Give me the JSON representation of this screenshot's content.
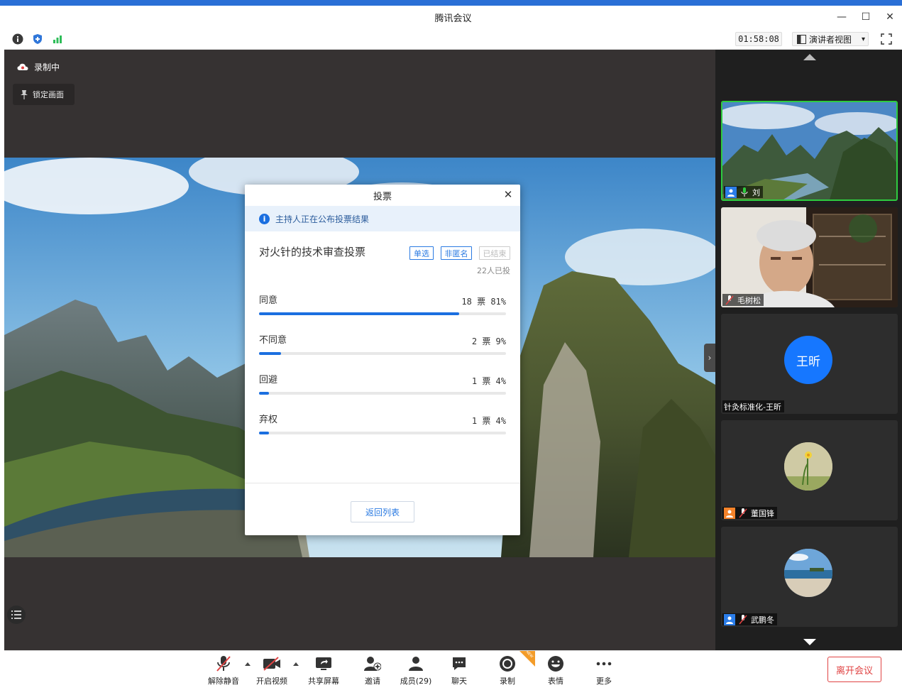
{
  "window": {
    "title": "腾讯会议",
    "minimize": "—",
    "maximize": "☐",
    "close": "✕"
  },
  "toolbar": {
    "timer": "01:58:08",
    "view_label": "演讲者视图",
    "view_caret": "▾"
  },
  "main": {
    "recording_label": "录制中",
    "lock_label": "锁定画面",
    "expand_arrow": "›"
  },
  "poll": {
    "dialog_title": "投票",
    "close": "✕",
    "notice": "主持人正在公布投票结果",
    "info_glyph": "i",
    "title": "对火针的技术审查投票",
    "tags": [
      "单选",
      "非匿名",
      "已结束"
    ],
    "voted": "22人已投",
    "options": [
      {
        "label": "同意",
        "count": "18 票 81%",
        "percent": 81
      },
      {
        "label": "不同意",
        "count": "2 票 9%",
        "percent": 9
      },
      {
        "label": "回避",
        "count": "1 票 4%",
        "percent": 4
      },
      {
        "label": "弃权",
        "count": "1 票 4%",
        "percent": 4
      }
    ],
    "back_button": "返回列表"
  },
  "participants": [
    {
      "name": "刘",
      "type": "video-landscape",
      "active": true
    },
    {
      "name": "毛树松",
      "type": "video-person"
    },
    {
      "name": "针灸标准化-王昕",
      "type": "avatar",
      "avatar_text": "王昕",
      "avatar_color": "#1677ff"
    },
    {
      "name": "董国锋",
      "type": "avatar-flower"
    },
    {
      "name": "武鹏冬",
      "type": "avatar-beach"
    }
  ],
  "bottombar": {
    "items": [
      "解除静音",
      "开启视频",
      "共享屏幕",
      "邀请",
      "成员(29)",
      "聊天",
      "录制",
      "表情",
      "更多"
    ],
    "leave": "离开会议",
    "new_badge": "NEW"
  },
  "colors": {
    "accent": "#1b6fe0",
    "leave": "#e04343",
    "active_border": "#2ecc40"
  }
}
